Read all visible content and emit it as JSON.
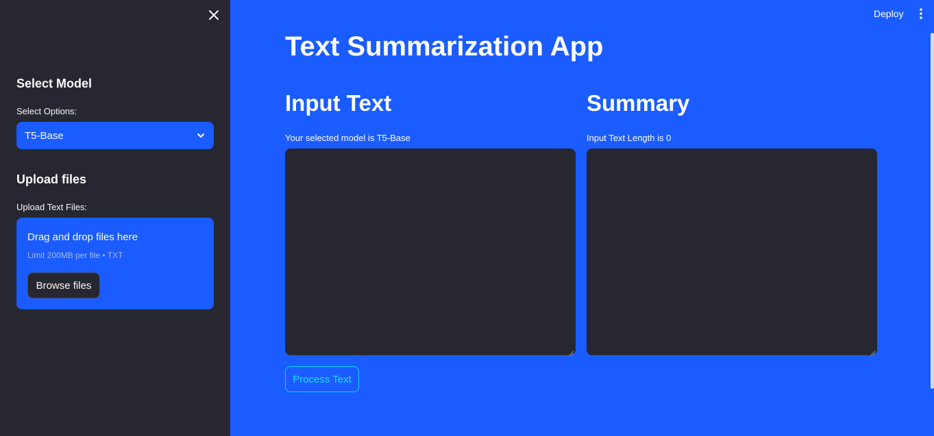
{
  "header": {
    "deploy_label": "Deploy"
  },
  "sidebar": {
    "model_heading": "Select Model",
    "model_select_label": "Select Options:",
    "model_selected": "T5-Base",
    "upload_heading": "Upload files",
    "upload_label": "Upload Text Files:",
    "dropzone_title": "Drag and drop files here",
    "dropzone_limit": "Limit 200MB per file • TXT",
    "browse_label": "Browse files"
  },
  "main": {
    "title": "Text Summarization App",
    "input_heading": "Input Text",
    "input_caption": "Your selected model is T5-Base",
    "summary_heading": "Summary",
    "summary_caption": "Input Text Length is 0",
    "input_text": "",
    "summary_text": "",
    "process_label": "Process Text"
  },
  "colors": {
    "background": "#1a5cff",
    "sidebar": "#262730",
    "textarea": "#262730",
    "process_accent": "#18e1ff"
  },
  "icons": [
    "close-icon",
    "chevron-down-icon",
    "more-vertical-icon",
    "resize-grip-icon"
  ]
}
